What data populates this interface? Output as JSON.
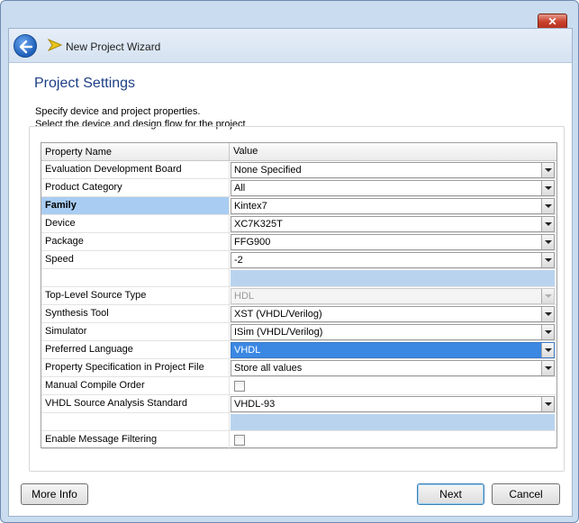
{
  "window": {
    "title": "New Project Wizard",
    "close_glyph": "✕"
  },
  "page": {
    "title": "Project Settings",
    "description_1": "Specify device and project properties.",
    "description_2": "Select the device and design flow for the project"
  },
  "grid": {
    "header": {
      "name": "Property Name",
      "value": "Value"
    },
    "rows": [
      {
        "name": "Evaluation Development Board",
        "value": "None Specified",
        "kind": "combo"
      },
      {
        "name": "Product Category",
        "value": "All",
        "kind": "combo"
      },
      {
        "name": "Family",
        "value": "Kintex7",
        "kind": "combo",
        "selected": true
      },
      {
        "name": "Device",
        "value": "XC7K325T",
        "kind": "combo"
      },
      {
        "name": "Package",
        "value": "FFG900",
        "kind": "combo"
      },
      {
        "name": "Speed",
        "value": "-2",
        "kind": "combo"
      },
      {
        "name": "",
        "value": "",
        "kind": "blank"
      },
      {
        "name": "Top-Level Source Type",
        "value": "HDL",
        "kind": "combo",
        "disabled": true
      },
      {
        "name": "Synthesis Tool",
        "value": "XST (VHDL/Verilog)",
        "kind": "combo"
      },
      {
        "name": "Simulator",
        "value": "ISim (VHDL/Verilog)",
        "kind": "combo"
      },
      {
        "name": "Preferred Language",
        "value": "VHDL",
        "kind": "combo",
        "highlight": true
      },
      {
        "name": "Property Specification in Project File",
        "value": "Store all values",
        "kind": "combo"
      },
      {
        "name": "Manual Compile Order",
        "value": false,
        "kind": "checkbox"
      },
      {
        "name": "VHDL Source Analysis Standard",
        "value": "VHDL-93",
        "kind": "combo"
      },
      {
        "name": "",
        "value": "",
        "kind": "blank"
      },
      {
        "name": "Enable Message Filtering",
        "value": false,
        "kind": "checkbox"
      }
    ]
  },
  "buttons": {
    "more_info": "More Info",
    "next": "Next",
    "cancel": "Cancel"
  },
  "colors": {
    "title_blue": "#1d3f86",
    "selection": "#a9cdf2",
    "highlight": "#3b88e3",
    "frame": "#c9dcf0"
  },
  "icons": {
    "back": "back-arrow-icon",
    "wizard": "wizard-arrow-icon",
    "dropdown": "chevron-down-icon"
  }
}
